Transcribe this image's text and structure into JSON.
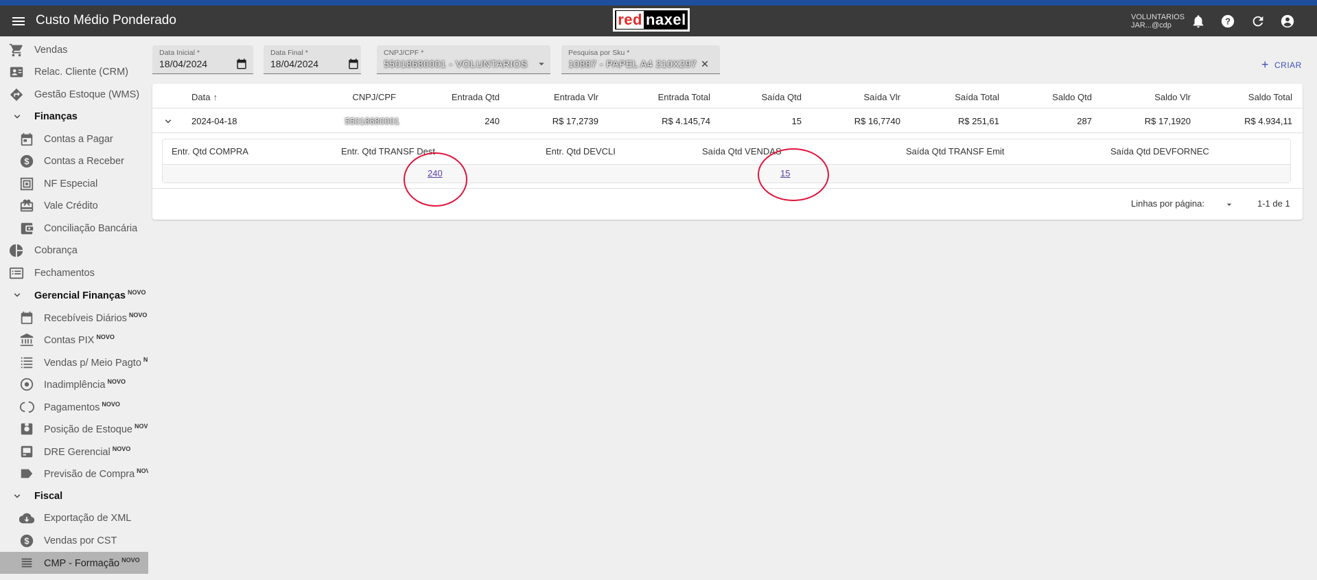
{
  "app": {
    "title": "Custo Médio Ponderado",
    "user": "VOLUNTARIOS JAR...@cdp"
  },
  "logo": {
    "part1": "red",
    "part2": "naxel"
  },
  "sidebar": {
    "items": [
      {
        "label": "Vendas",
        "icon": "cart-icon"
      },
      {
        "label": "Relac. Cliente (CRM)",
        "icon": "contact-card-icon"
      },
      {
        "label": "Gestão Estoque (WMS)",
        "icon": "directions-icon"
      },
      {
        "label": "Finanças",
        "icon": "chevron-down-icon",
        "group": true
      },
      {
        "label": "Contas a Pagar",
        "icon": "calendar-icon"
      },
      {
        "label": "Contas a Receber",
        "icon": "dollar-circle-icon"
      },
      {
        "label": "NF Especial",
        "icon": "document-frame-icon"
      },
      {
        "label": "Vale Crédito",
        "icon": "card-giftcard-icon"
      },
      {
        "label": "Conciliação Bancária",
        "icon": "wallet-icon"
      },
      {
        "label": "Cobrança",
        "icon": "pie-chart-icon"
      },
      {
        "label": "Fechamentos",
        "icon": "list-box-icon"
      },
      {
        "label": "Gerencial Finanças",
        "badge": "NOVO",
        "icon": "chevron-down-icon",
        "group": true
      },
      {
        "label": "Recebíveis Diários",
        "badge": "NOVO",
        "icon": "calendar-icon"
      },
      {
        "label": "Contas PIX",
        "badge": "NOVO",
        "icon": "bank-icon"
      },
      {
        "label": "Vendas p/ Meio Pagto",
        "badge": "N",
        "icon": "list-dots-icon"
      },
      {
        "label": "Inadimplência",
        "badge": "NOVO",
        "icon": "target-icon"
      },
      {
        "label": "Pagamentos",
        "badge": "NOVO",
        "icon": "return-icon"
      },
      {
        "label": "Posição de Estoque",
        "badge": "NOV",
        "icon": "inventory-icon"
      },
      {
        "label": "DRE Gerencial",
        "badge": "NOVO",
        "icon": "report-icon"
      },
      {
        "label": "Previsão de Compra",
        "badge": "NOV",
        "icon": "label-icon"
      },
      {
        "label": "Fiscal",
        "icon": "chevron-down-icon",
        "group": true
      },
      {
        "label": "Exportação de XML",
        "icon": "cloud-download-icon"
      },
      {
        "label": "Vendas por CST",
        "icon": "dollar-circle-icon"
      },
      {
        "label": "CMP - Formação",
        "badge": "NOVO",
        "icon": "list-lines-icon",
        "active": true
      }
    ]
  },
  "filters": {
    "data_inicial": {
      "label": "Data Inicial *",
      "value": "18/04/2024"
    },
    "data_final": {
      "label": "Data Final *",
      "value": "18/04/2024"
    },
    "cnpj": {
      "label": "CNPJ/CPF *",
      "value": "55018680001 - VOLUNTARIOS"
    },
    "sku": {
      "label": "Pesquisa por Sku *",
      "value": "10887 - PAPEL A4 210X297"
    },
    "criar": "CRIAR"
  },
  "table": {
    "headers": [
      "Data",
      "CNPJ/CPF",
      "Entrada Qtd",
      "Entrada Vlr",
      "Entrada Total",
      "Saída Qtd",
      "Saída Vlr",
      "Saída Total",
      "Saldo Qtd",
      "Saldo Vlr",
      "Saldo Total"
    ],
    "row": [
      "2024-04-18",
      "55018680001",
      "240",
      "R$ 17,2739",
      "R$ 4.145,74",
      "15",
      "R$ 16,7740",
      "R$ 251,61",
      "287",
      "R$ 17,1920",
      "R$ 4.934,11"
    ],
    "detail_headers": [
      "Entr. Qtd COMPRA",
      "Entr. Qtd TRANSF Dest",
      "Entr. Qtd DEVCLI",
      "Saída Qtd VENDAS",
      "Saída Qtd TRANSF Emit",
      "Saída Qtd DEVFORNEC"
    ],
    "detail_values": {
      "transf_dest": "240",
      "vendas": "15"
    },
    "pager": {
      "rows_label": "Linhas por página:",
      "range": "1-1 de 1"
    }
  },
  "colors": {
    "appbar": "#3a3a3a",
    "stripe": "#1e4f9c",
    "annotation": "#e0143c",
    "link": "#5a3fa8"
  }
}
